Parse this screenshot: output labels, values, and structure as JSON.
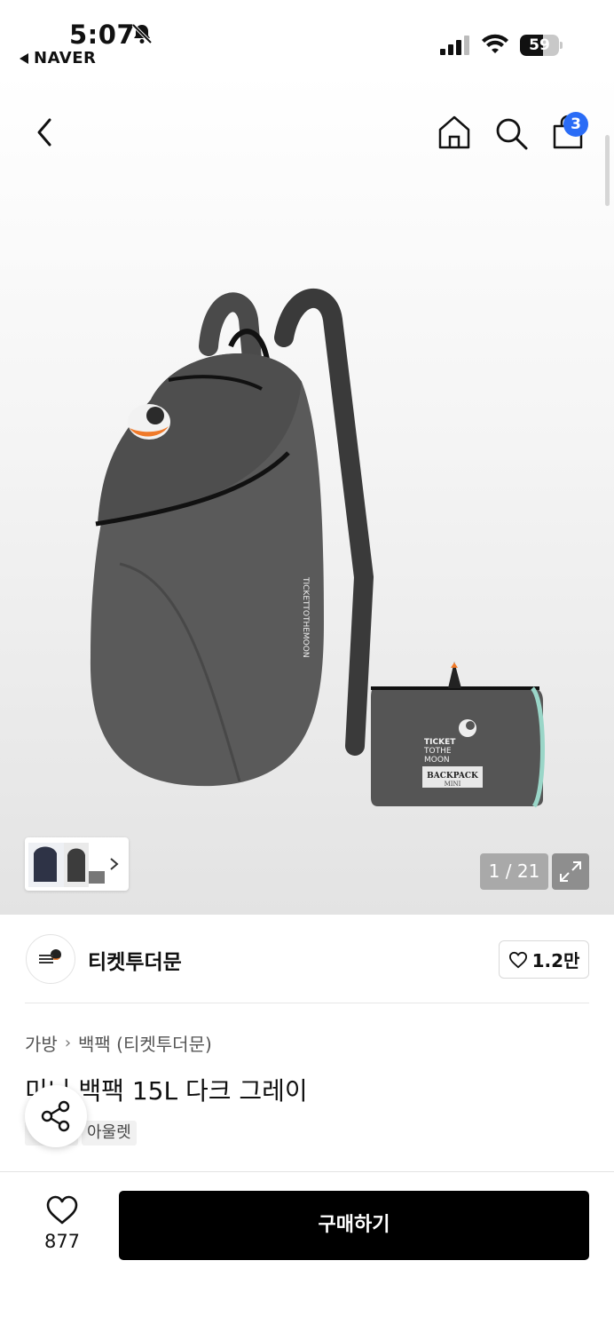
{
  "status_bar": {
    "time": "5:07",
    "back_app": "NAVER",
    "battery": "59",
    "battery_level": 0.59,
    "icons": [
      "bell-slash-icon",
      "signal-icon",
      "wifi-icon",
      "battery-icon"
    ]
  },
  "nav": {
    "icons": [
      "chevron-left-icon",
      "home-icon",
      "search-icon",
      "shopping-bag-icon"
    ],
    "cart_badge": "3"
  },
  "gallery": {
    "counter": "1 / 21",
    "product_image_text": {
      "brand_line1": "TICKET",
      "brand_line2": "TOTHE",
      "brand_line3": "MOON",
      "label_line1": "BACKPACK",
      "label_line2": "MINI",
      "strap_text": "TICKETTOTHEMOON"
    }
  },
  "brand": {
    "name": "티켓투더문",
    "like_count": "1.2만"
  },
  "breadcrumb": [
    "가방",
    "백팩 (티켓투더문)"
  ],
  "product": {
    "title": "미니 백팩 15L 다크 그레이",
    "tags": [
      "",
      "아울렛"
    ]
  },
  "bottom": {
    "wish_count": "877",
    "buy_label": "구매하기"
  },
  "colors": {
    "accent_badge": "#2a6cf6",
    "buy_button": "#000000"
  }
}
